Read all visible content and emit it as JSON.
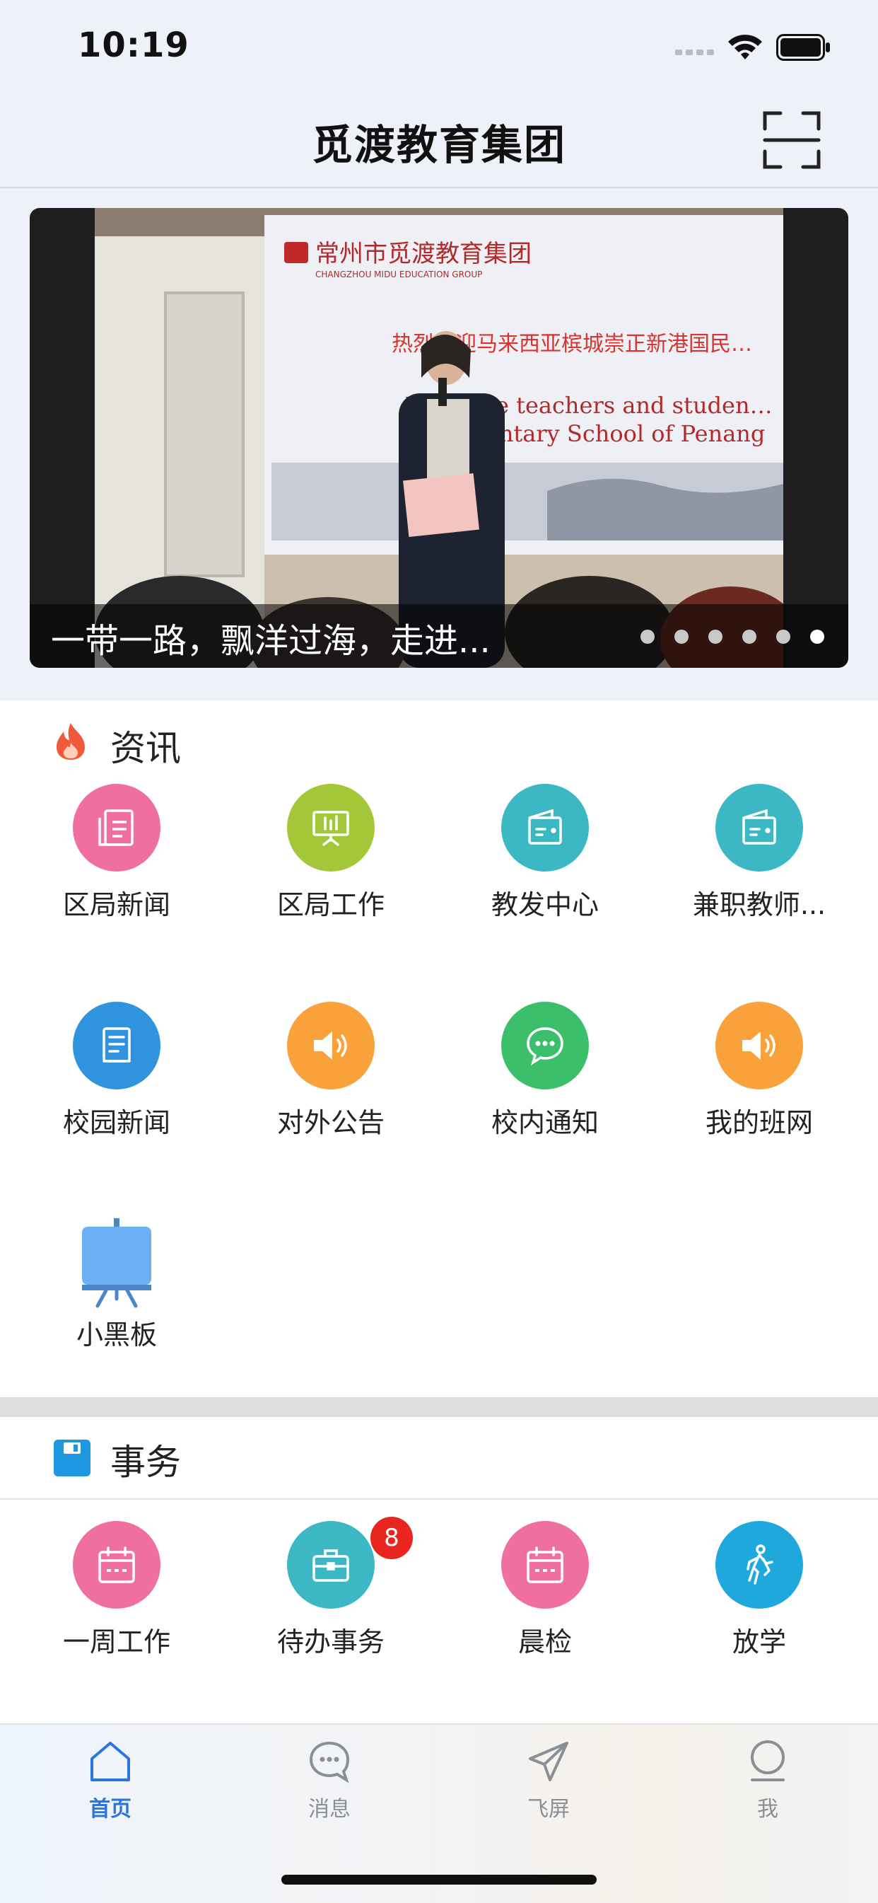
{
  "status_bar": {
    "time": "10:19"
  },
  "nav": {
    "title": "觅渡教育集团"
  },
  "banner": {
    "caption": "一带一路，飘洋过海，走进...",
    "dots": 6,
    "active_dot": 6,
    "slide_heading": "常州市觅渡教育集团",
    "slide_heading_en": "CHANGZHOU MIDU EDUCATION GROUP",
    "slide_line1": "热烈欢迎马来西亚槟城崇正新港国民…",
    "slide_line2": "Welcome teachers and studen…",
    "slide_line3": "Elementary School of Penang"
  },
  "news": {
    "title": "资讯",
    "items": [
      {
        "label": "区局新闻",
        "icon": "document-icon",
        "color": "#ef6fa0"
      },
      {
        "label": "区局工作",
        "icon": "presentation-icon",
        "color": "#a4c639"
      },
      {
        "label": "教发中心",
        "icon": "wallet-icon",
        "color": "#3bb8c4"
      },
      {
        "label": "兼职教师...",
        "icon": "wallet-icon",
        "color": "#3bb8c4"
      },
      {
        "label": "校园新闻",
        "icon": "notebook-icon",
        "color": "#2f93dd"
      },
      {
        "label": "对外公告",
        "icon": "speaker-icon",
        "color": "#f9a13a"
      },
      {
        "label": "校内通知",
        "icon": "chat-icon",
        "color": "#3cbf6a"
      },
      {
        "label": "我的班网",
        "icon": "speaker-icon",
        "color": "#f9a13a"
      },
      {
        "label": "小黑板",
        "icon": "blackboard-icon",
        "color": "#6ab0f3"
      }
    ]
  },
  "affairs": {
    "title": "事务",
    "items": [
      {
        "label": "一周工作",
        "icon": "calendar-icon",
        "color": "#ef6fa0"
      },
      {
        "label": "待办事务",
        "icon": "briefcase-icon",
        "color": "#3bb8c4",
        "badge": "8"
      },
      {
        "label": "晨检",
        "icon": "calendar-icon",
        "color": "#ef6fa0"
      },
      {
        "label": "放学",
        "icon": "walking-icon",
        "color": "#1fa8dc"
      }
    ]
  },
  "tabbar": {
    "tabs": [
      {
        "label": "首页",
        "icon": "home-icon",
        "active": true
      },
      {
        "label": "消息",
        "icon": "message-icon",
        "active": false
      },
      {
        "label": "飞屏",
        "icon": "send-icon",
        "active": false
      },
      {
        "label": "我",
        "icon": "profile-icon",
        "active": false
      }
    ]
  },
  "colors": {
    "accent": "#2a75e0",
    "badge": "#e8251f",
    "fire": "#f05a3a",
    "affairs_icon": "#1e96e0"
  }
}
